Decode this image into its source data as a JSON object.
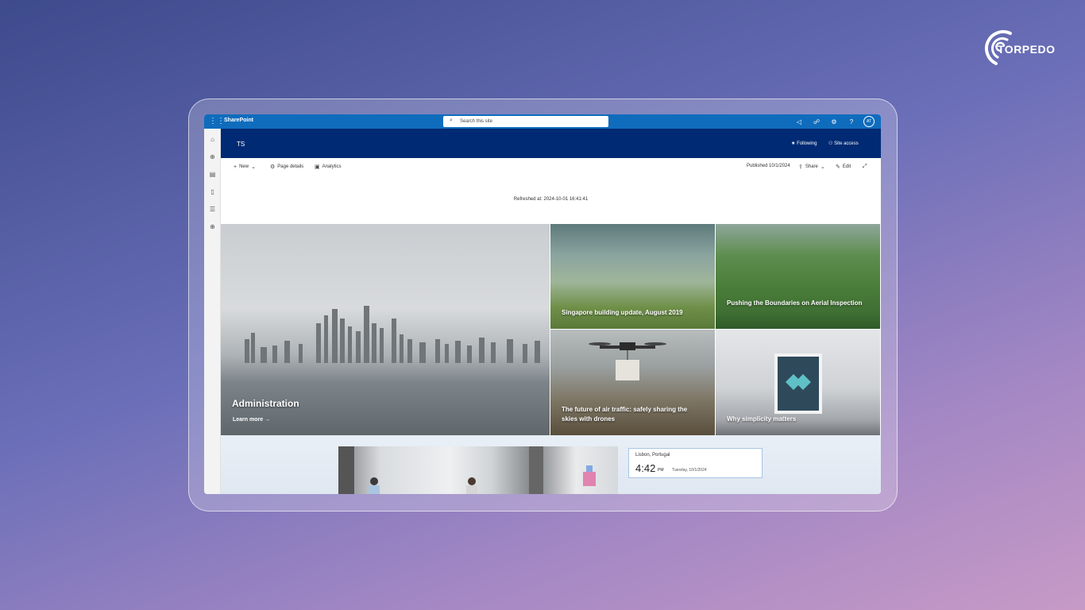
{
  "brand": {
    "name": "TORPEDO"
  },
  "suitebar": {
    "app_name": "SharePoint",
    "search_placeholder": "Search this site",
    "avatar_initials": "AT"
  },
  "site": {
    "title": "TS",
    "following_label": "Following",
    "site_access_label": "Site access"
  },
  "commandbar": {
    "new_label": "New",
    "page_details_label": "Page details",
    "analytics_label": "Analytics",
    "published_label": "Published 10/1/2024",
    "share_label": "Share",
    "edit_label": "Edit"
  },
  "refreshed_text": "Refreshed at: 2024-10-01 16:41:41",
  "hero": {
    "main_title": "Administration",
    "learn_more": "Learn more →",
    "tiles": [
      {
        "title": "Singapore building update, August 2019"
      },
      {
        "title": "Pushing the Boundaries on Aerial Inspection"
      },
      {
        "title": "The future of air traffic: safely sharing the skies with drones"
      },
      {
        "title": "Why simplicity matters"
      }
    ]
  },
  "clock": {
    "location": "Lisbon, Portugal",
    "time": "4:42",
    "ampm": "PM",
    "date": "Tuesday, 10/1/2024"
  },
  "colors": {
    "suitebar": "#0f6cbd",
    "site_header": "#002a73"
  }
}
